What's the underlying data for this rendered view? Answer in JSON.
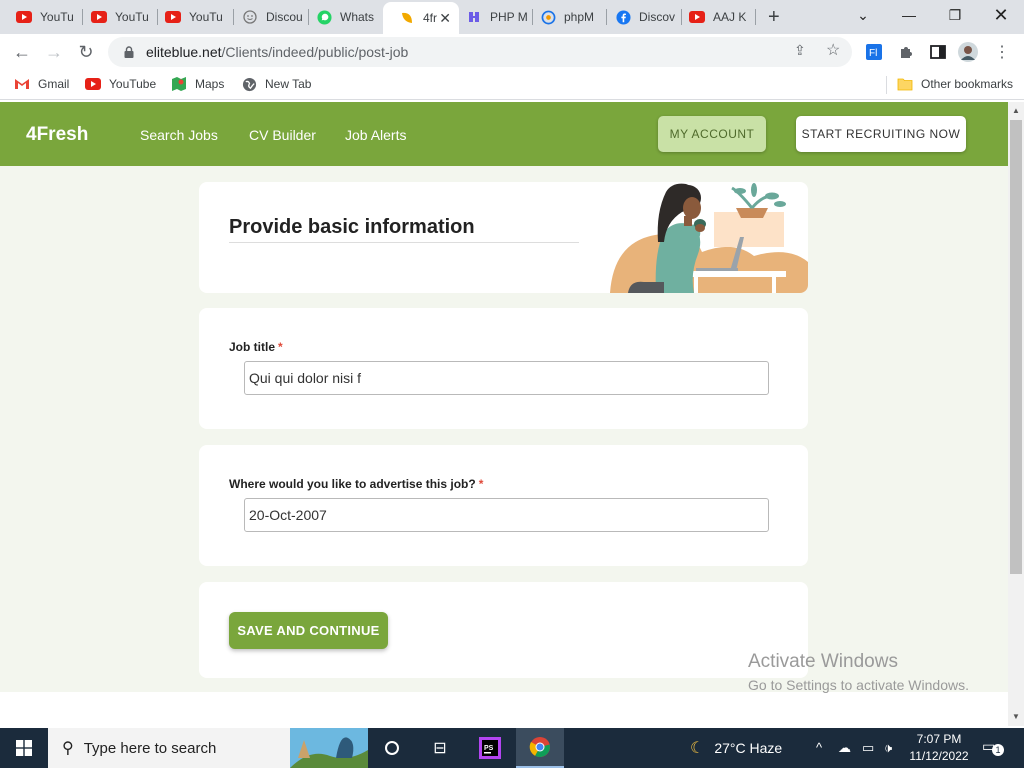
{
  "browser": {
    "tabs": [
      {
        "title": "YouTu",
        "icon": "youtube-icon"
      },
      {
        "title": "YouTu",
        "icon": "youtube-icon"
      },
      {
        "title": "YouTu",
        "icon": "youtube-icon"
      },
      {
        "title": "Discou",
        "icon": "discord-icon"
      },
      {
        "title": "Whats",
        "icon": "whatsapp-icon"
      },
      {
        "title": "4fr",
        "icon": "4fresh-icon",
        "active": true
      },
      {
        "title": "PHP M",
        "icon": "php-icon"
      },
      {
        "title": "phpM",
        "icon": "phpmyadmin-icon"
      },
      {
        "title": "Discov",
        "icon": "facebook-icon"
      },
      {
        "title": "AAJ K",
        "icon": "youtube-icon"
      }
    ],
    "new_tab": "+",
    "url": {
      "host": "eliteblue.net",
      "path": "/Clients/indeed/public/post-job"
    },
    "bookmarks": [
      {
        "label": "Gmail",
        "icon": "gmail-icon"
      },
      {
        "label": "YouTube",
        "icon": "youtube-icon"
      },
      {
        "label": "Maps",
        "icon": "maps-icon"
      },
      {
        "label": "New Tab",
        "icon": "globe-icon"
      }
    ],
    "other_bookmarks": "Other bookmarks"
  },
  "site": {
    "brand": "4Fresh",
    "nav": [
      "Search Jobs",
      "CV Builder",
      "Job Alerts"
    ],
    "my_account": "MY ACCOUNT",
    "start_recruiting": "START RECRUITING NOW"
  },
  "form": {
    "heading": "Provide basic information",
    "job_title": {
      "label": "Job title",
      "required_mark": "*",
      "value": "Qui qui dolor nisi f"
    },
    "advertise": {
      "label": "Where would you like to advertise this job?",
      "required_mark": "*",
      "value": "20-Oct-2007"
    },
    "submit": "SAVE AND CONTINUE"
  },
  "watermark": {
    "title": "Activate Windows",
    "subtitle": "Go to Settings to activate Windows."
  },
  "taskbar": {
    "search_placeholder": "Type here to search",
    "weather": "27°C  Haze",
    "time": "7:07 PM",
    "date": "11/12/2022",
    "notifications": "1"
  },
  "colors": {
    "brand_green": "#7aa63c",
    "account_btn": "#c9e1a6",
    "page_bg": "#f3f6ee",
    "required": "#e04a3a"
  }
}
